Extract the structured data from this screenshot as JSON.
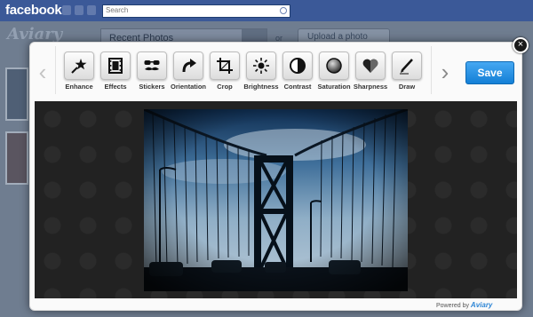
{
  "facebook": {
    "logo": "facebook",
    "search_placeholder": "Search"
  },
  "background": {
    "brand": "Aviary",
    "album_select": "Recent Photos",
    "or_label": "or",
    "upload_button": "Upload a photo"
  },
  "editor": {
    "tools": [
      {
        "label": "Enhance",
        "icon": "magic-wand-star-icon"
      },
      {
        "label": "Effects",
        "icon": "film-strip-icon"
      },
      {
        "label": "Stickers",
        "icon": "mustache-glasses-icon"
      },
      {
        "label": "Orientation",
        "icon": "rotate-icon"
      },
      {
        "label": "Crop",
        "icon": "crop-icon"
      },
      {
        "label": "Brightness",
        "icon": "sun-icon"
      },
      {
        "label": "Contrast",
        "icon": "contrast-icon"
      },
      {
        "label": "Saturation",
        "icon": "saturation-circle-icon"
      },
      {
        "label": "Sharpness",
        "icon": "heart-icon"
      },
      {
        "label": "Draw",
        "icon": "pen-icon"
      }
    ],
    "pager": {
      "pages": 3,
      "active_index": 0
    },
    "save_label": "Save",
    "close_symbol": "×",
    "powered_by": "Powered by",
    "powered_brand": "Aviary"
  },
  "colors": {
    "facebook_blue": "#3b5998",
    "save_blue": "#2e86d6"
  }
}
